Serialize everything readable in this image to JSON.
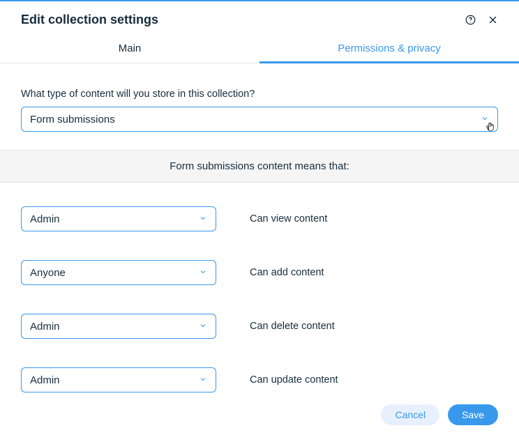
{
  "header": {
    "title": "Edit collection settings"
  },
  "tabs": {
    "main": "Main",
    "permissions": "Permissions & privacy"
  },
  "question": {
    "label": "What type of content will you store in this collection?",
    "selected": "Form submissions"
  },
  "subheader": "Form submissions content means that:",
  "permissions": [
    {
      "role": "Admin",
      "label": "Can view content"
    },
    {
      "role": "Anyone",
      "label": "Can add content"
    },
    {
      "role": "Admin",
      "label": "Can delete content"
    },
    {
      "role": "Admin",
      "label": "Can update content"
    }
  ],
  "footer": {
    "cancel": "Cancel",
    "save": "Save"
  }
}
